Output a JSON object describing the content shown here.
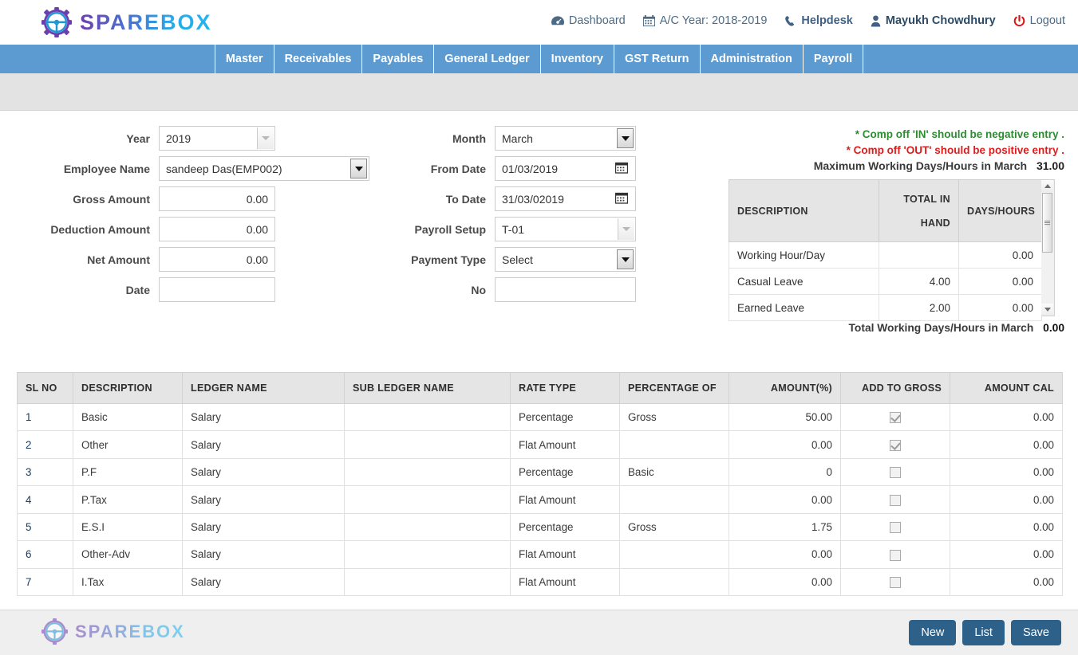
{
  "brand": {
    "name": "SPAREBOX"
  },
  "header": {
    "links": [
      {
        "label": "Dashboard",
        "icon": "dashboard-icon"
      },
      {
        "label": "A/C Year: 2018-2019",
        "icon": "calendar-icon"
      },
      {
        "label": "Helpdesk",
        "icon": "phone-icon"
      },
      {
        "label": "Mayukh Chowdhury",
        "icon": "user-icon"
      },
      {
        "label": "Logout",
        "icon": "power-icon"
      }
    ]
  },
  "nav": {
    "items": [
      {
        "label": "Master"
      },
      {
        "label": "Receivables"
      },
      {
        "label": "Payables"
      },
      {
        "label": "General Ledger"
      },
      {
        "label": "Inventory"
      },
      {
        "label": "GST Return"
      },
      {
        "label": "Administration"
      },
      {
        "label": "Payroll"
      }
    ]
  },
  "form": {
    "left": [
      {
        "label": "Year",
        "value": "2019",
        "type": "select",
        "state": "disabled"
      },
      {
        "label": "Employee Name",
        "value": "sandeep Das(EMP002)",
        "type": "select",
        "state": "active"
      },
      {
        "label": "Gross Amount",
        "value": "0.00",
        "type": "number"
      },
      {
        "label": "Deduction Amount",
        "value": "0.00",
        "type": "number"
      },
      {
        "label": "Net Amount",
        "value": "0.00",
        "type": "number"
      },
      {
        "label": "Date",
        "value": "",
        "type": "text"
      }
    ],
    "middle": [
      {
        "label": "Month",
        "value": "March",
        "type": "select",
        "state": "active"
      },
      {
        "label": "From Date",
        "value": "01/03/2019",
        "type": "date"
      },
      {
        "label": "To Date",
        "value": "31/03/02019",
        "type": "date"
      },
      {
        "label": "Payroll Setup",
        "value": "T-01",
        "type": "select",
        "state": "disabled"
      },
      {
        "label": "Payment Type",
        "value": "Select",
        "type": "select",
        "state": "active"
      },
      {
        "label": "No",
        "value": "",
        "type": "text"
      }
    ]
  },
  "notes": {
    "green": "* Comp off 'IN' should be negative entry .",
    "red": "* Comp off 'OUT' should be positive entry .",
    "green_color": "#2e8b32",
    "red_color": "#e01b1b"
  },
  "summary": {
    "max_label": "Maximum Working Days/Hours in March",
    "max_value": "31.00",
    "headers": {
      "description": "DESCRIPTION",
      "total_in_hand_line1": "TOTAL IN",
      "total_in_hand_line2": "HAND",
      "days_hours": "DAYS/HOURS"
    },
    "rows": [
      {
        "description": "Working Hour/Day",
        "total_in_hand": "",
        "days_hours": "0.00"
      },
      {
        "description": "Casual Leave",
        "total_in_hand": "4.00",
        "days_hours": "0.00"
      },
      {
        "description": "Earned Leave",
        "total_in_hand": "2.00",
        "days_hours": "0.00"
      }
    ],
    "total_label": "Total Working Days/Hours in March",
    "total_value": "0.00"
  },
  "table": {
    "headers": [
      "SL NO",
      "DESCRIPTION",
      "LEDGER NAME",
      "SUB LEDGER NAME",
      "RATE TYPE",
      "PERCENTAGE OF",
      "AMOUNT(%)",
      "ADD TO GROSS",
      "AMOUNT CAL"
    ],
    "rows": [
      {
        "sl": "1",
        "description": "Basic",
        "ledger": "Salary",
        "sub_ledger": "",
        "rate_type": "Percentage",
        "percentage_of": "Gross",
        "amount_pct": "50.00",
        "add_to_gross": true,
        "amount_cal": "0.00"
      },
      {
        "sl": "2",
        "description": "Other",
        "ledger": "Salary",
        "sub_ledger": "",
        "rate_type": "Flat Amount",
        "percentage_of": "",
        "amount_pct": "0.00",
        "add_to_gross": true,
        "amount_cal": "0.00"
      },
      {
        "sl": "3",
        "description": "P.F",
        "ledger": "Salary",
        "sub_ledger": "",
        "rate_type": "Percentage",
        "percentage_of": "Basic",
        "amount_pct": "0",
        "add_to_gross": false,
        "amount_cal": "0.00"
      },
      {
        "sl": "4",
        "description": "P.Tax",
        "ledger": "Salary",
        "sub_ledger": "",
        "rate_type": "Flat Amount",
        "percentage_of": "",
        "amount_pct": "0.00",
        "add_to_gross": false,
        "amount_cal": "0.00"
      },
      {
        "sl": "5",
        "description": "E.S.I",
        "ledger": "Salary",
        "sub_ledger": "",
        "rate_type": "Percentage",
        "percentage_of": "Gross",
        "amount_pct": "1.75",
        "add_to_gross": false,
        "amount_cal": "0.00"
      },
      {
        "sl": "6",
        "description": "Other-Adv",
        "ledger": "Salary",
        "sub_ledger": "",
        "rate_type": "Flat Amount",
        "percentage_of": "",
        "amount_pct": "0.00",
        "add_to_gross": false,
        "amount_cal": "0.00"
      },
      {
        "sl": "7",
        "description": "I.Tax",
        "ledger": "Salary",
        "sub_ledger": "",
        "rate_type": "Flat Amount",
        "percentage_of": "",
        "amount_pct": "0.00",
        "add_to_gross": false,
        "amount_cal": "0.00"
      }
    ]
  },
  "footer": {
    "buttons": [
      {
        "label": "New"
      },
      {
        "label": "List"
      },
      {
        "label": "Save"
      }
    ],
    "button_color": "#2e618a"
  }
}
